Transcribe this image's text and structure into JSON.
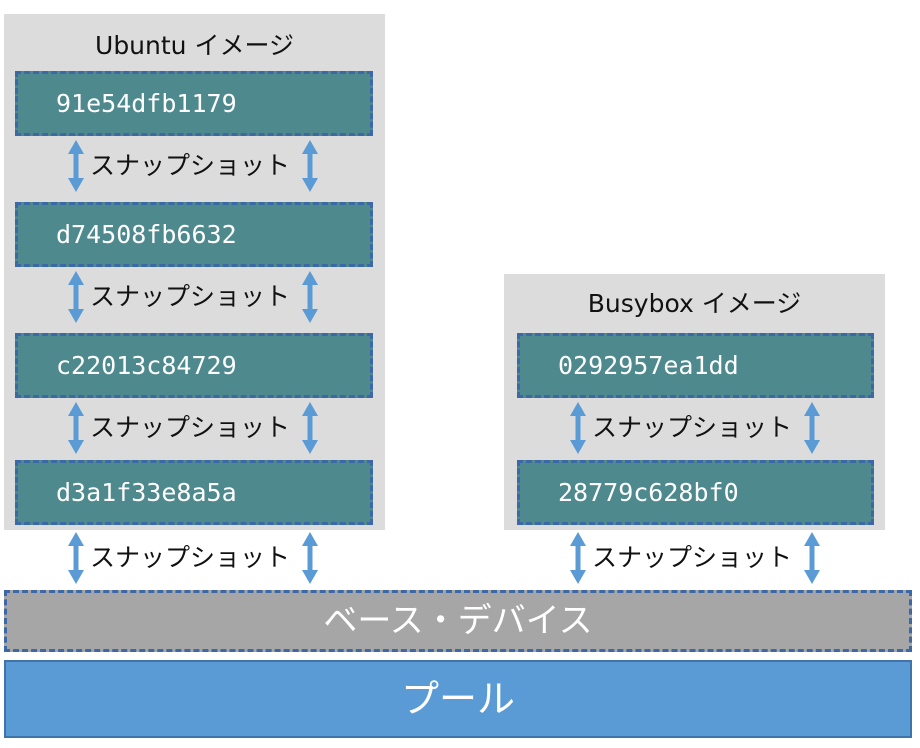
{
  "ubuntu": {
    "title": "Ubuntu イメージ",
    "layers": [
      "91e54dfb1179",
      "d74508fb6632",
      "c22013c84729",
      "d3a1f33e8a5a"
    ]
  },
  "busybox": {
    "title": "Busybox イメージ",
    "layers": [
      "0292957ea1dd",
      "28779c628bf0"
    ]
  },
  "snapshot_label": "スナップショット",
  "base_device": "ベース・デバイス",
  "pool": "プール",
  "colors": {
    "panel": "#dcdcdc",
    "layer_fill": "#4e8a8d",
    "layer_border": "#3d68a7",
    "arrow": "#5b9bd5",
    "base_fill": "#a6a6a6",
    "pool_fill": "#5b9bd5"
  }
}
